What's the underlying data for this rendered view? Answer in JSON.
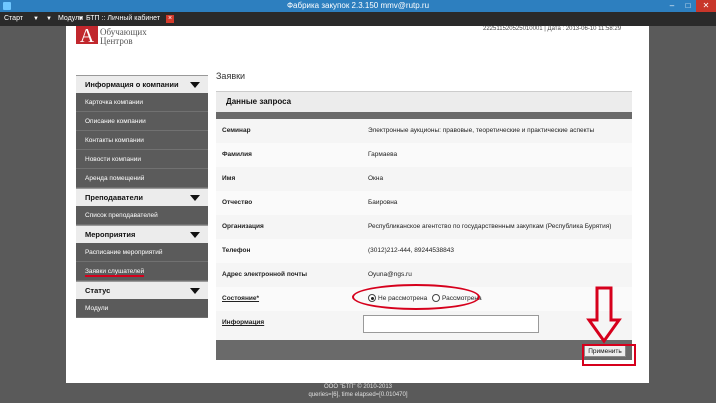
{
  "window": {
    "title": "Фабрика закупок 2.3.150 mmv@rutp.ru"
  },
  "taskbar": {
    "start": "Старт",
    "modules": "Модули",
    "tab": "БТП :: Личный кабинет"
  },
  "header": {
    "logo_line1": "Обучающих",
    "logo_line2": "Центров",
    "right_text": "222511520525010001 | Дата : 2013-06-10 11:58:29"
  },
  "sidebar": {
    "sections": [
      {
        "title": "Информация о компании",
        "items": [
          "Карточка компании",
          "Описание компании",
          "Контакты компании",
          "Новости компании",
          "Аренда помещений"
        ]
      },
      {
        "title": "Преподаватели",
        "items": [
          "Список преподавателей"
        ]
      },
      {
        "title": "Мероприятия",
        "items": [
          "Расписание мероприятий",
          "Заявки слушателей"
        ]
      },
      {
        "title": "Статус",
        "items": [
          "Модули"
        ]
      }
    ]
  },
  "main": {
    "page_title": "Заявки",
    "panel_title": "Данные запроса",
    "rows": [
      {
        "label": "Семинар",
        "value": "Электронные аукционы: правовые, теоретические и практические аспекты"
      },
      {
        "label": "Фамилия",
        "value": "Гармаева"
      },
      {
        "label": "Имя",
        "value": "Окна"
      },
      {
        "label": "Отчество",
        "value": "Баировна"
      },
      {
        "label": "Организация",
        "value": "Республиканское агентство по государственным закупкам (Республика Бурятия)"
      },
      {
        "label": "Телефон",
        "value": "(3012)212-444, 89244538843"
      },
      {
        "label": "Адрес электронной почты",
        "value": "Oyuna@ngs.ru"
      }
    ],
    "state": {
      "label": "Состояние*",
      "options": [
        "Не рассмотрена",
        "Рассмотрена"
      ],
      "selected": "Не рассмотрена"
    },
    "info": {
      "label": "Информация",
      "value": ""
    },
    "apply_button": "Применить"
  },
  "footer": {
    "line1": "ООО \"БТП\" © 2010-2013",
    "line2": "queries=[6], time elapsed=[0.010470]"
  }
}
